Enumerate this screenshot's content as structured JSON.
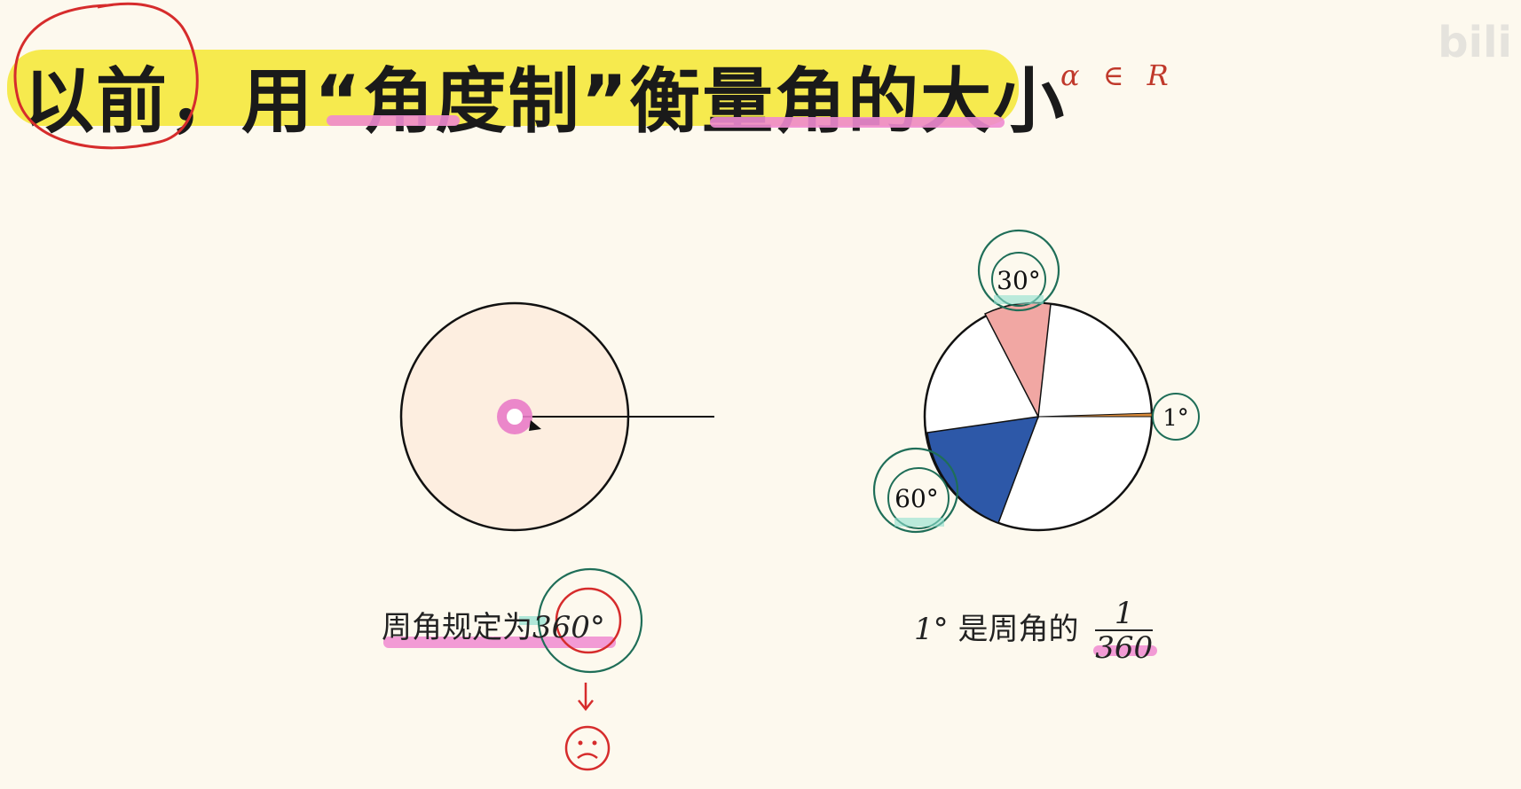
{
  "title": "以前，用“角度制”衡量角的大小",
  "annotation": "α ∈ R",
  "watermark": "bili",
  "left_diagram": {
    "caption_text": "周角规定为",
    "caption_value": "360°"
  },
  "right_diagram": {
    "labels": {
      "thirty": "30°",
      "one": "1°",
      "sixty": "60°"
    },
    "caption_prefix": "1°",
    "caption_text": "是周角的",
    "fraction_num": "1",
    "fraction_den": "360"
  },
  "colors": {
    "title_highlight": "#f6ea4e",
    "pink_underline": "#f08bd0",
    "red_annotation": "#d62c2c",
    "teal_circle": "#1f6e58",
    "slice_30": "#f1a7a3",
    "slice_60": "#2d58a8",
    "slice_1": "#d98a3a",
    "left_circle_fill": "#fdeee0",
    "center_pink": "#e97bc8"
  },
  "icons": [
    "sad-face-icon",
    "down-arrow-icon"
  ]
}
